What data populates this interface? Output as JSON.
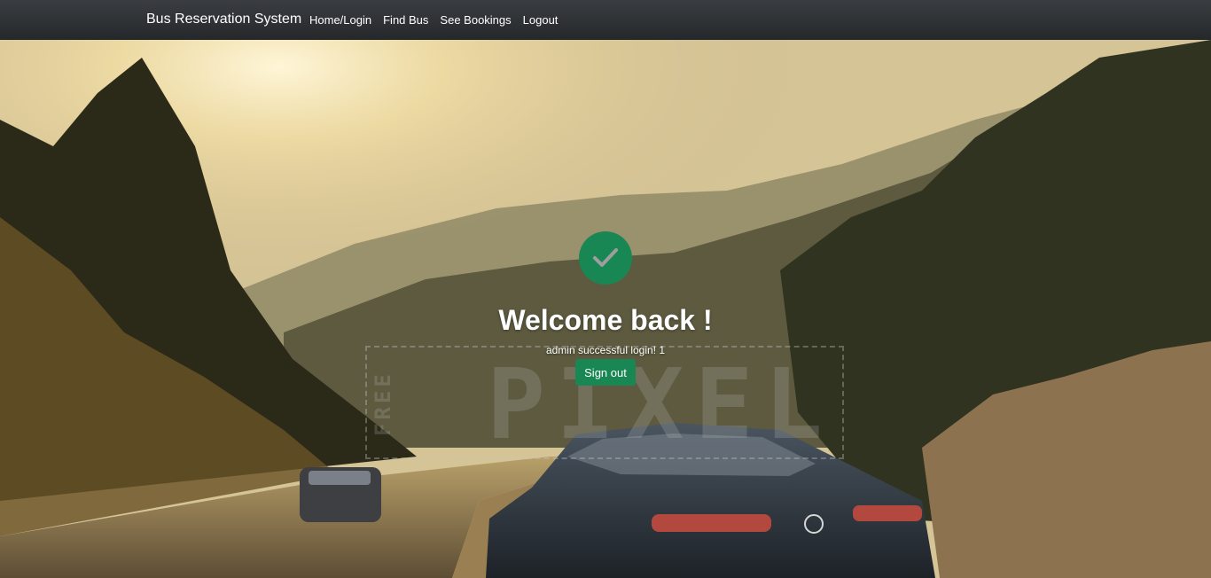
{
  "navbar": {
    "brand": "Bus Reservation System",
    "links": [
      {
        "label": "Home/Login"
      },
      {
        "label": "Find Bus"
      },
      {
        "label": "See Bookings"
      },
      {
        "label": "Logout"
      }
    ]
  },
  "main": {
    "icon": "check-icon",
    "title": "Welcome back !",
    "message": "admin successful login! 1",
    "signout_label": "Sign out"
  },
  "background": {
    "watermark_word": "PIXEL",
    "watermark_small": "FREE"
  },
  "colors": {
    "navbar": "#2c2f33",
    "accent": "#198754",
    "text": "#ffffff"
  }
}
